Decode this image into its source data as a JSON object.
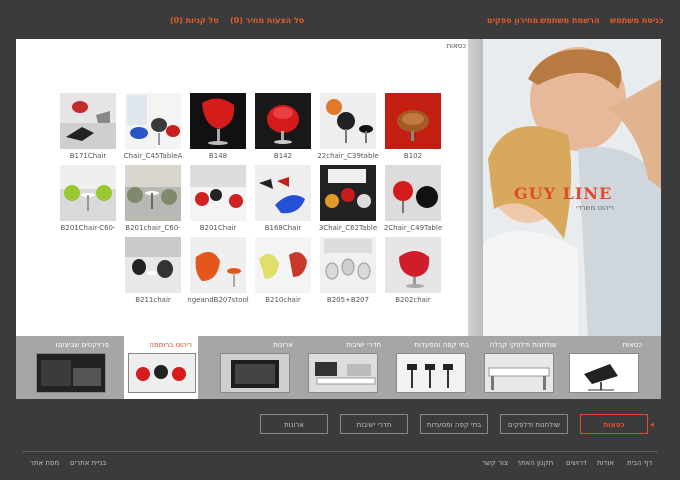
{
  "top_nav": {
    "login": "כניסת משתמש",
    "register": "הרשמת משתמש",
    "catalog": "מחירון ספקים",
    "quotes_cart": "סל הצעות מחיר (0)",
    "shopping_cart": "סל קניות (0)"
  },
  "main": {
    "title": "כסאות",
    "products": [
      "B171Chair",
      "Chair_C45TableA",
      "B148",
      "B142",
      "22chair_C39table",
      "B102",
      "B201Chair-C60-",
      "B201chair_C60-",
      "B201Chair",
      "B168Chair",
      "3Chair_C62Table",
      "2Chair_C49Table",
      "B211chair",
      "ngeandB207stool",
      "B210chair",
      "B205+B207",
      "B202chair"
    ]
  },
  "banner": {
    "logo": "GUY LINE",
    "tagline": "ריהוט משרדי"
  },
  "categories": [
    {
      "label": "כסאות"
    },
    {
      "label": "שולחנות ודלפקי קבלה"
    },
    {
      "label": "בתי קפה ומסעדות"
    },
    {
      "label": "חדרי ישיבות"
    },
    {
      "label": "ארונות"
    },
    {
      "label": "ריהוט ברוממה"
    },
    {
      "label": "פרויקטים שביצענו"
    }
  ],
  "buttons": {
    "chairs": "כסאות",
    "tables": "שולחנות ודלפקים",
    "cafes": "בתי קפה ומסעדות",
    "meeting": "חדרי ישיבות",
    "cabinets": "ארונות"
  },
  "footer": {
    "home": "דף הבית",
    "about": "אודות",
    "jobs": "דרושים",
    "terms": "תקנון האתר",
    "contact": "צור קשר",
    "site_building": "בניית אתרים",
    "sitemap": "מפת אתר"
  },
  "colors": {
    "accent": "#e04b2b",
    "background": "#3b3b3b"
  }
}
